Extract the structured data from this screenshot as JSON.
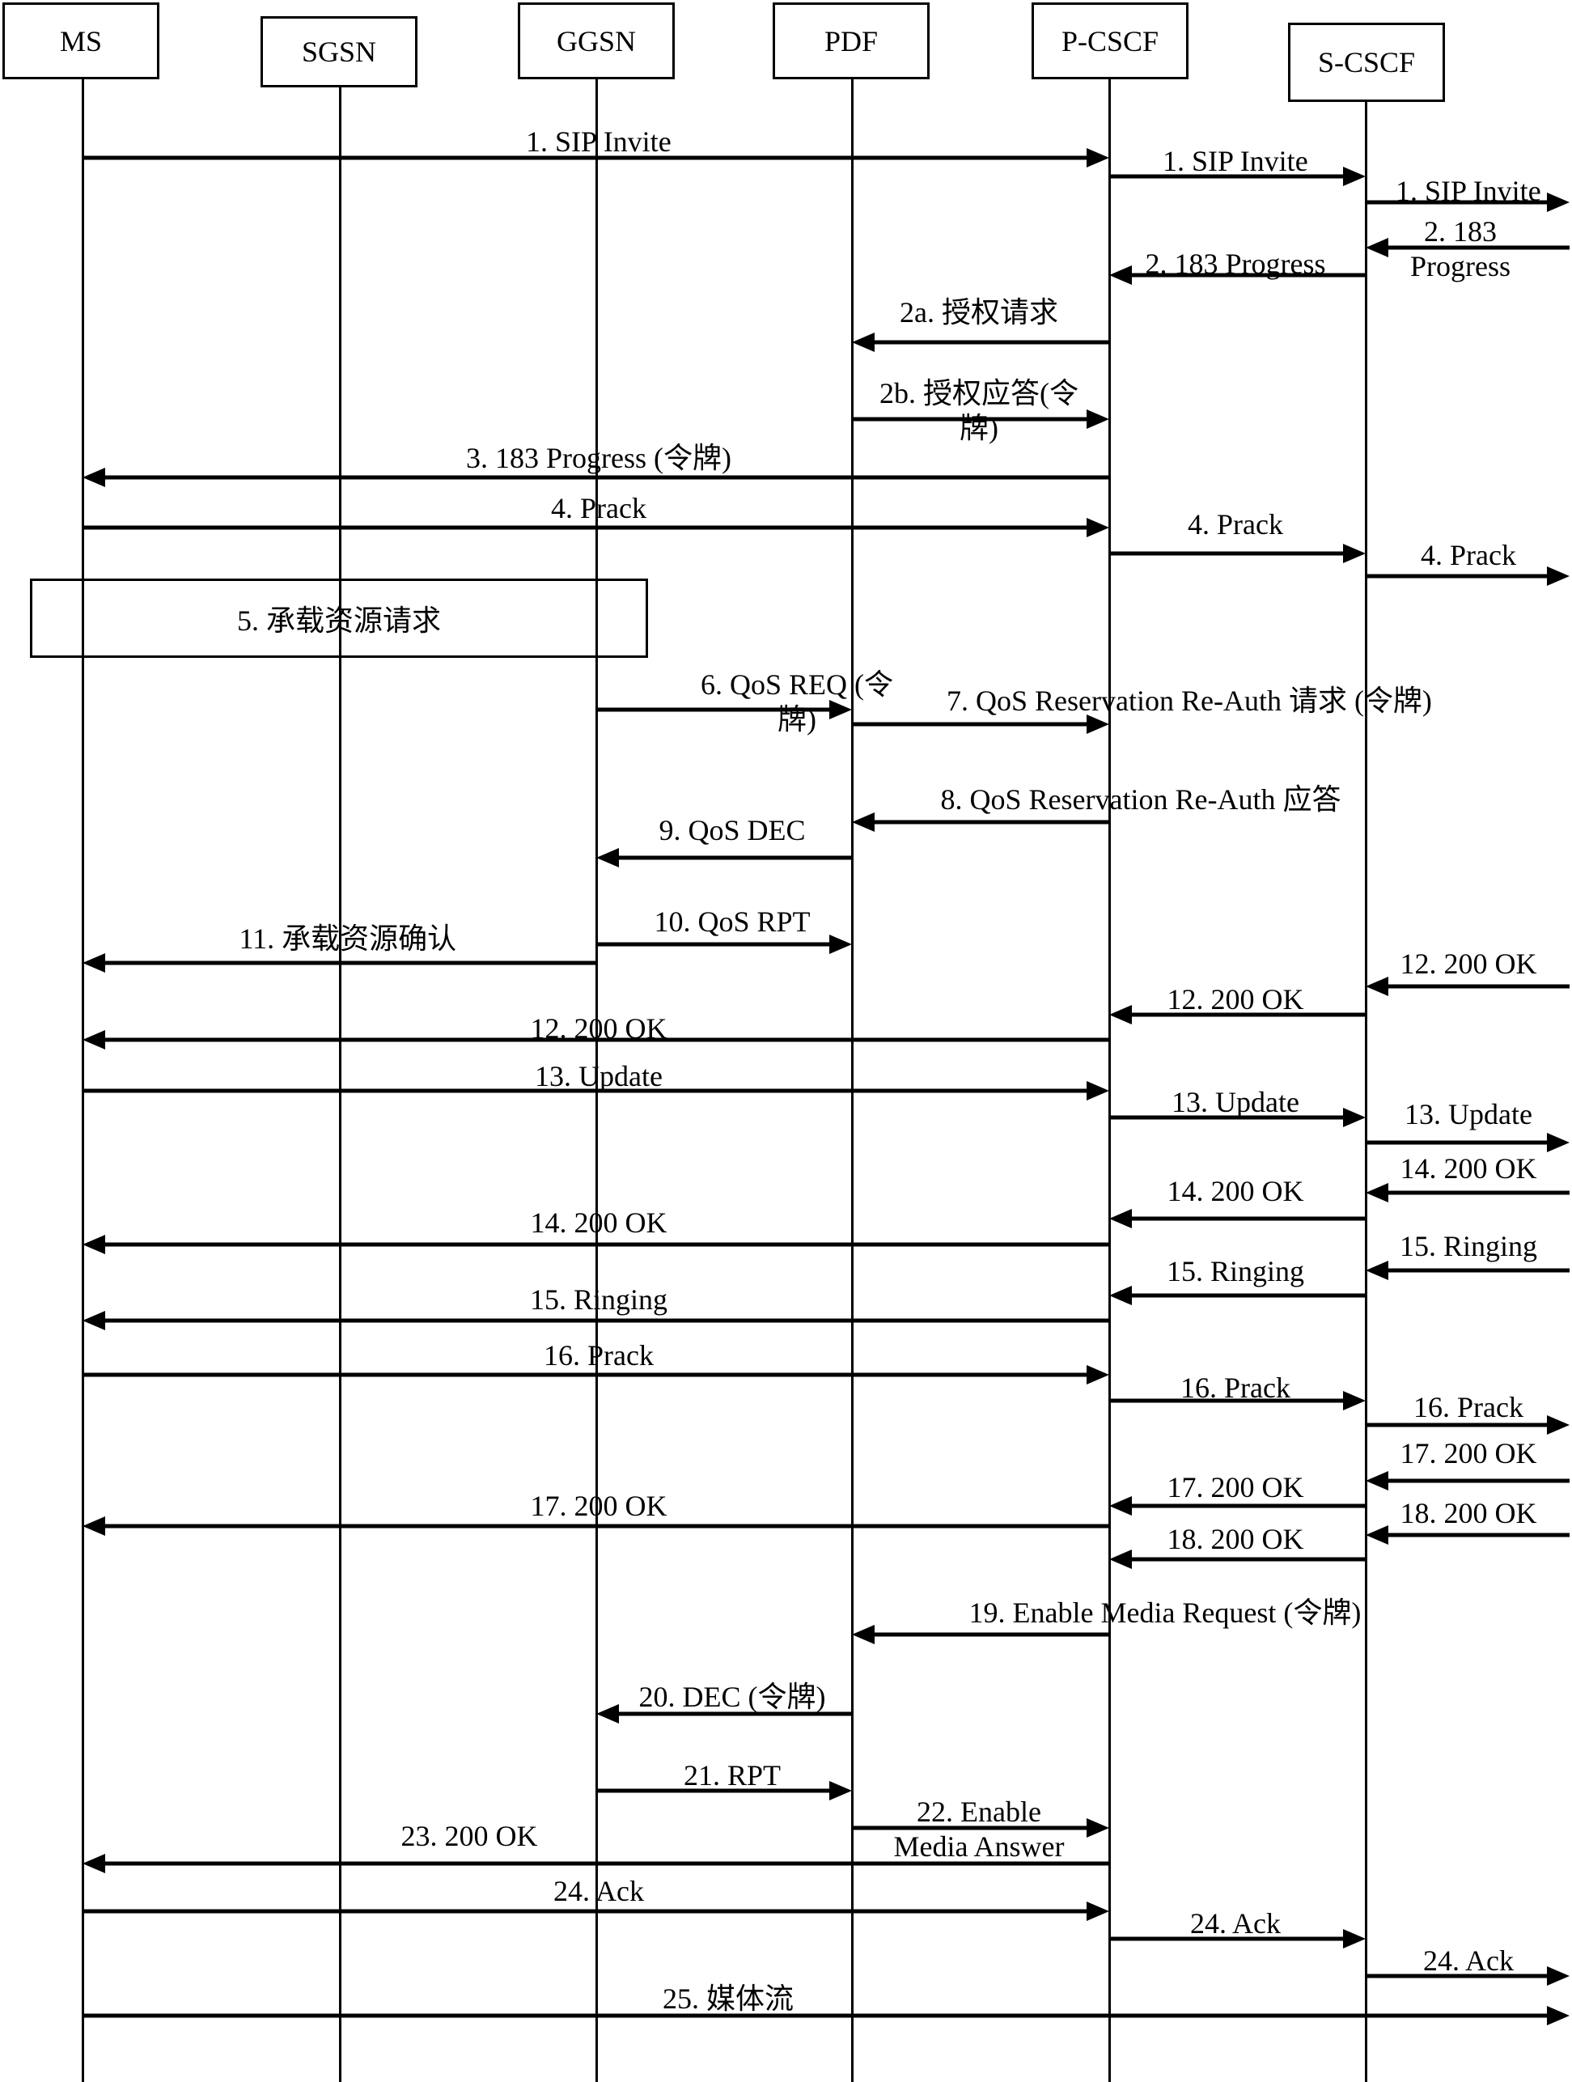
{
  "participants": [
    {
      "id": "MS",
      "label": "MS"
    },
    {
      "id": "SGSN",
      "label": "SGSN"
    },
    {
      "id": "GGSN",
      "label": "GGSN"
    },
    {
      "id": "PDF",
      "label": "PDF"
    },
    {
      "id": "PCSCF",
      "label": "P-CSCF"
    },
    {
      "id": "SCSCF",
      "label": "S-CSCF"
    }
  ],
  "note": {
    "label": "5. 承载资源请求",
    "from": "MS",
    "to": "GGSN"
  },
  "messages": [
    {
      "label": "1. SIP Invite",
      "from": "MS",
      "to": "PCSCF"
    },
    {
      "label": "1. SIP Invite",
      "from": "PCSCF",
      "to": "SCSCF"
    },
    {
      "label": "1. SIP Invite",
      "from": "SCSCF",
      "to": "EXT"
    },
    {
      "label": "2. 183\nProgress",
      "from": "EXT",
      "to": "SCSCF"
    },
    {
      "label": "2. 183 Progress",
      "from": "SCSCF",
      "to": "PCSCF"
    },
    {
      "label": "2a. 授权请求",
      "from": "PCSCF",
      "to": "PDF"
    },
    {
      "label": "2b. 授权应答(令\n牌)",
      "from": "PDF",
      "to": "PCSCF"
    },
    {
      "label": "3. 183 Progress (令牌)",
      "from": "PCSCF",
      "to": "MS"
    },
    {
      "label": "4. Prack",
      "from": "MS",
      "to": "PCSCF"
    },
    {
      "label": "4. Prack",
      "from": "PCSCF",
      "to": "SCSCF"
    },
    {
      "label": "4. Prack",
      "from": "SCSCF",
      "to": "EXT"
    },
    {
      "label": "6. QoS REQ (令\n牌)",
      "from": "GGSN",
      "to": "PDF"
    },
    {
      "label": "7. QoS Reservation Re-Auth 请求 (令牌)",
      "from": "PDF",
      "to": "PCSCF"
    },
    {
      "label": "8. QoS Reservation Re-Auth 应答",
      "from": "PCSCF",
      "to": "PDF"
    },
    {
      "label": "9. QoS DEC",
      "from": "PDF",
      "to": "GGSN"
    },
    {
      "label": "10. QoS RPT",
      "from": "GGSN",
      "to": "PDF"
    },
    {
      "label": "11. 承载资源确认",
      "from": "GGSN",
      "to": "MS"
    },
    {
      "label": "12. 200 OK",
      "from": "EXT",
      "to": "SCSCF"
    },
    {
      "label": "12. 200 OK",
      "from": "SCSCF",
      "to": "PCSCF"
    },
    {
      "label": "12. 200 OK",
      "from": "PCSCF",
      "to": "MS"
    },
    {
      "label": "13. Update",
      "from": "MS",
      "to": "PCSCF"
    },
    {
      "label": "13. Update",
      "from": "PCSCF",
      "to": "SCSCF"
    },
    {
      "label": "13. Update",
      "from": "SCSCF",
      "to": "EXT"
    },
    {
      "label": "14. 200 OK",
      "from": "EXT",
      "to": "SCSCF"
    },
    {
      "label": "14. 200 OK",
      "from": "SCSCF",
      "to": "PCSCF"
    },
    {
      "label": "14. 200 OK",
      "from": "PCSCF",
      "to": "MS"
    },
    {
      "label": "15. Ringing",
      "from": "EXT",
      "to": "SCSCF"
    },
    {
      "label": "15. Ringing",
      "from": "SCSCF",
      "to": "PCSCF"
    },
    {
      "label": "15. Ringing",
      "from": "PCSCF",
      "to": "MS"
    },
    {
      "label": "16. Prack",
      "from": "MS",
      "to": "PCSCF"
    },
    {
      "label": "16. Prack",
      "from": "PCSCF",
      "to": "SCSCF"
    },
    {
      "label": "16. Prack",
      "from": "SCSCF",
      "to": "EXT"
    },
    {
      "label": "17. 200 OK",
      "from": "EXT",
      "to": "SCSCF"
    },
    {
      "label": "17. 200 OK",
      "from": "SCSCF",
      "to": "PCSCF"
    },
    {
      "label": "17. 200 OK",
      "from": "PCSCF",
      "to": "MS"
    },
    {
      "label": "18. 200 OK",
      "from": "EXT",
      "to": "SCSCF"
    },
    {
      "label": "18. 200 OK",
      "from": "SCSCF",
      "to": "PCSCF"
    },
    {
      "label": "19. Enable Media Request (令牌)",
      "from": "PCSCF",
      "to": "PDF"
    },
    {
      "label": "20. DEC (令牌)",
      "from": "PDF",
      "to": "GGSN"
    },
    {
      "label": "21. RPT",
      "from": "GGSN",
      "to": "PDF"
    },
    {
      "label": "22. Enable\nMedia Answer",
      "from": "PDF",
      "to": "PCSCF"
    },
    {
      "label": "23. 200 OK",
      "from": "PCSCF",
      "to": "MS"
    },
    {
      "label": "24. Ack",
      "from": "MS",
      "to": "PCSCF"
    },
    {
      "label": "24. Ack",
      "from": "PCSCF",
      "to": "SCSCF"
    },
    {
      "label": "24. Ack",
      "from": "SCSCF",
      "to": "EXT"
    },
    {
      "label": "25. 媒体流",
      "from": "MS",
      "to": "EXT"
    }
  ]
}
